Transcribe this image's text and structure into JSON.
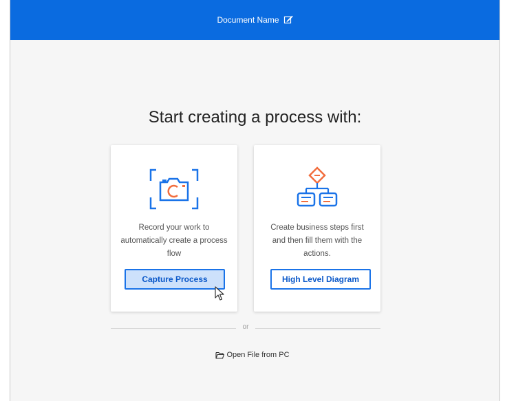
{
  "header": {
    "document_name": "Document Name",
    "edit_icon": "edit-icon"
  },
  "main": {
    "heading": "Start creating a process with:",
    "cards": [
      {
        "icon": "camera-capture-icon",
        "description": "Record your work to automatically create a process flow",
        "button_label": "Capture Process"
      },
      {
        "icon": "flowchart-diagram-icon",
        "description": "Create business steps first and then fill them with the actions.",
        "button_label": "High Level Diagram"
      }
    ],
    "separator_text": "or",
    "open_file": {
      "icon": "folder-open-icon",
      "label": "Open File from PC"
    }
  },
  "colors": {
    "topbar": "#0a6be0",
    "accent": "#1a73e8",
    "diagram_orange": "#f26d3d",
    "selected_button_fill": "#cde1fb"
  }
}
